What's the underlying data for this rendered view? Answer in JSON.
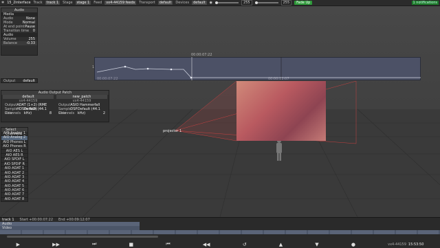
{
  "topbar": {
    "app_icon": "app-icon",
    "project": "15_2interface",
    "track_label": "Track",
    "track_value": "track 1",
    "stage_label": "Stage",
    "stage_value": "stage 1",
    "feed_label": "Feed",
    "feed_value": "vx4-44159 feeds",
    "transport_label": "Transport",
    "transport_value": "default",
    "devices_label": "Devices",
    "devices_value": "default",
    "volume_value": "255",
    "volume2_value": "255",
    "fade_button": "Fade Up",
    "notification": "1 notifications",
    "colors": {
      "accent_green": "#2e9a3a"
    }
  },
  "media_panel": {
    "header": "Audio",
    "media_section": "Media",
    "rows": [
      {
        "label": "Audio",
        "value": "None"
      },
      {
        "label": "Mode",
        "value": "Normal"
      },
      {
        "label": "At end point",
        "value": "Pause"
      },
      {
        "label": "Transition time",
        "value": "0"
      }
    ],
    "audio_section": "Audio",
    "volume_label": "Volume",
    "volume_value": "255",
    "balance_label": "Balance",
    "balance_value": "-0.33"
  },
  "output_panel": {
    "label": "Output",
    "value": "default"
  },
  "automation": {
    "timecode": "00:00:07:22",
    "y_label": "1",
    "start_time": "00:00:07:22",
    "end_time": "00:00:12:07"
  },
  "patch_panel": {
    "header": "Audio Output Patch",
    "columns": [
      {
        "name": "default",
        "device_id": "vx4-44159",
        "output_label": "Output",
        "output_value": "ADAT (1+2) (RME HDSPe AIO)",
        "rate_label": "Sample Rate",
        "rate_value": "Default (44.1 kHz)",
        "channels_label": "Channels",
        "channels_value": "8"
      },
      {
        "name": "new_patch",
        "device_id": "vx4-44159",
        "output_label": "Output",
        "output_value": "ASIO Hammerfall DSP",
        "rate_label": "Sample Rate",
        "rate_value": "Default (44.1 kHz)",
        "channels_label": "Channels",
        "channels_value": "2"
      }
    ]
  },
  "scene": {
    "projector_label": "projector 1",
    "image_alt": "Projected image"
  },
  "channels_panel": {
    "header": "Select Channels",
    "items": [
      "AIO Analog 1",
      "AIO Analog 2",
      "AIO Phones L",
      "AIO Phones R",
      "AIO AES L",
      "AIO AES R",
      "AIO SPDIF L",
      "AIO SPDIF R",
      "AIO ADAT 1",
      "AIO ADAT 2",
      "AIO ADAT 3",
      "AIO ADAT 4",
      "AIO ADAT 5",
      "AIO ADAT 6",
      "AIO ADAT 7",
      "AIO ADAT 8"
    ],
    "selected_index": 1
  },
  "timeline": {
    "track_name": "track 1",
    "start_label": "Start +00:00:07:22",
    "end_label": "End +00:09:12:07",
    "tracks": [
      "Audio",
      "Video"
    ],
    "device_readout": "vx4-44159",
    "time_readout": "15:53:50"
  }
}
